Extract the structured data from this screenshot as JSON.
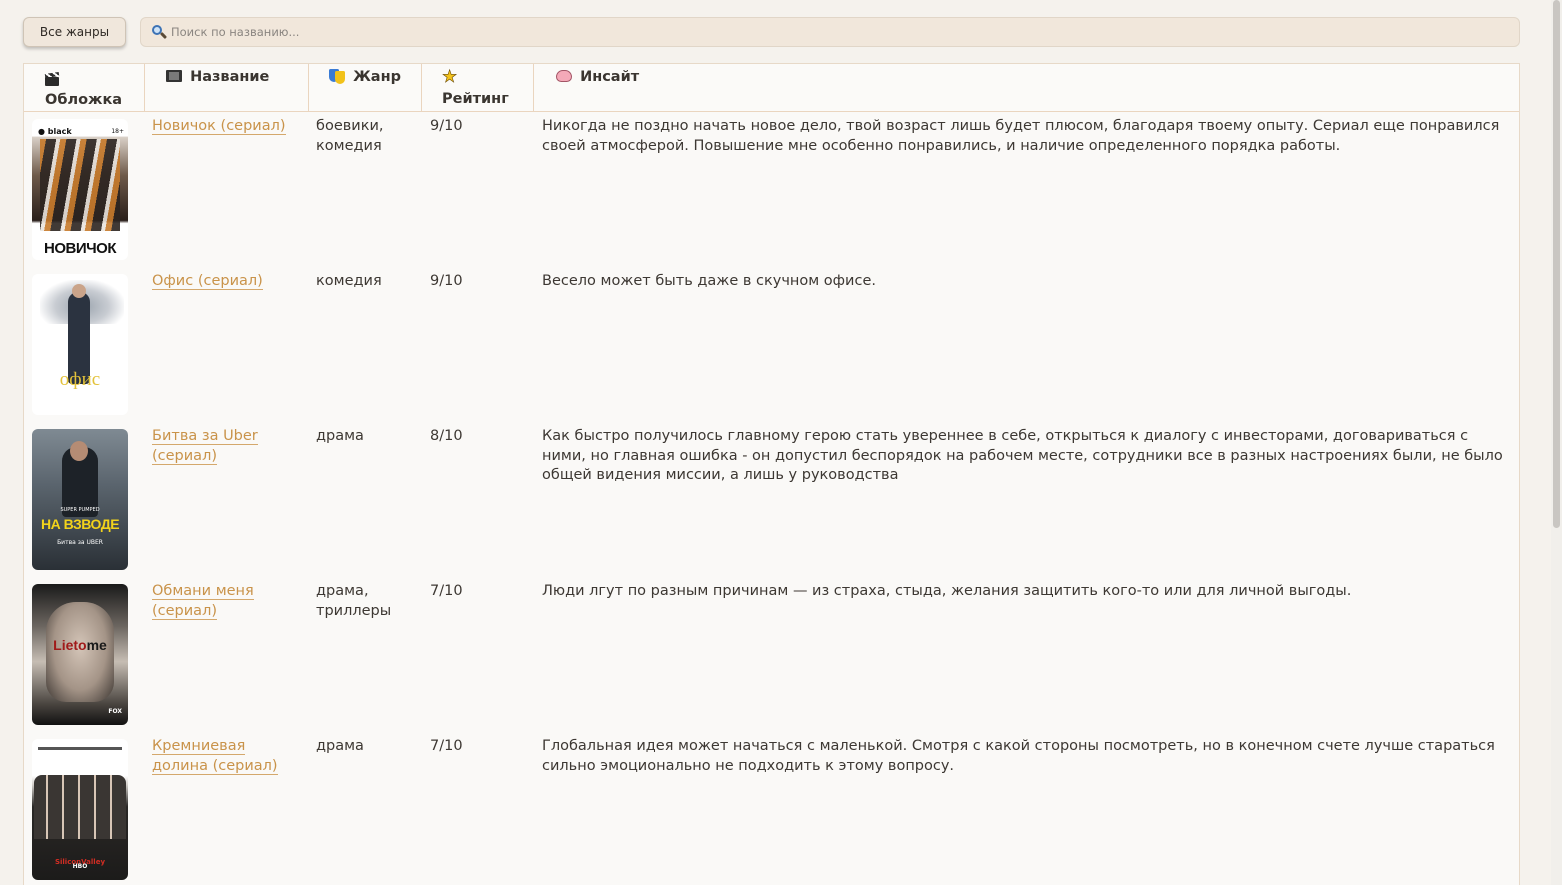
{
  "toolbar": {
    "genre_button_label": "Все жанры",
    "search_placeholder": "Поиск по названию..."
  },
  "table": {
    "headers": {
      "cover": "Обложка",
      "title": "Название",
      "genre": "Жанр",
      "rating": "Рейтинг",
      "insight": "Инсайт"
    },
    "header_icons": {
      "cover": "clapperboard-icon",
      "title": "film-frames-icon",
      "genre": "theater-masks-icon",
      "rating": "star-icon",
      "insight": "brain-icon"
    },
    "rows": [
      {
        "title": "Новичок (сериал)",
        "genre": "боевики, комедия",
        "rating": "9/10",
        "insight": "Никогда не поздно начать новое дело, твой возраст лишь будет плюсом, благодаря твоему опыту. Сериал еще понравился своей атмосферой. Повышение мне особенно понравились, и наличие определенного порядка работы.",
        "poster": {
          "title": "НОВИЧОК",
          "brand": "● black",
          "age": "18+"
        }
      },
      {
        "title": "Офис (сериал)",
        "genre": "комедия",
        "rating": "9/10",
        "insight": "Весело может быть даже в скучном офисе.",
        "poster": {
          "title": "офис"
        }
      },
      {
        "title": "Битва за Uber (сериал)",
        "genre": "драма",
        "rating": "8/10",
        "insight": "Как быстро получилось главному герою стать увереннее в себе, открыться к диалогу с инвесторами, договариваться с ними, но главная ошибка - он допустил беспорядок на рабочем месте, сотрудники все в разных настроениях были, не было общей видения миссии, а лишь у руководства",
        "poster": {
          "title": "НА ВЗВОДЕ",
          "subtitle": "SUPER PUMPED",
          "caption": "Битва за UBER"
        }
      },
      {
        "title": "Обмани меня (сериал)",
        "genre": "драма, триллеры",
        "rating": "7/10",
        "insight": "Люди лгут по разным причинам — из страха, стыда, желания защитить кого-то или для личной выгоды.",
        "poster": {
          "title_a": "Lie",
          "title_b": "to",
          "title_c": "me",
          "network": "FOX"
        }
      },
      {
        "title": "Кремниевая долина (сериал)",
        "genre": "драма",
        "rating": "7/10",
        "insight": "Глобальная идея может начаться с маленькой. Смотря с какой стороны посмотреть, но в конечном счете лучше стараться сильно эмоционально не подходить к этому вопросу.",
        "poster": {
          "title": "SiliconValley",
          "network": "HBO"
        }
      }
    ]
  },
  "colors": {
    "background": "#f5f2ed",
    "link": "#c9934a",
    "border": "#ead5bf",
    "text": "#3d3833"
  }
}
